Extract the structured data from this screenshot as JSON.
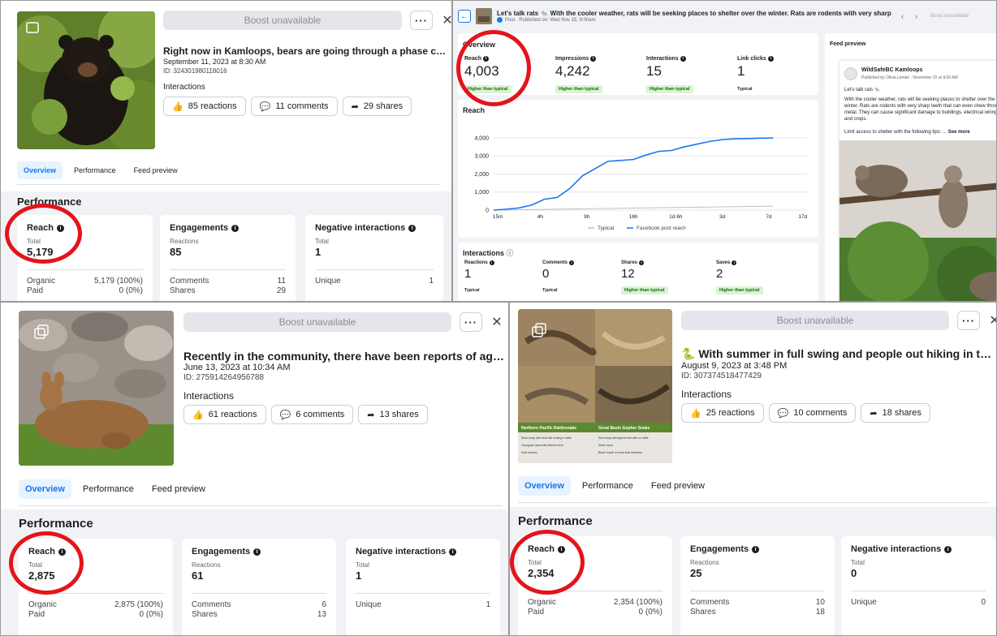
{
  "panels": {
    "bears": {
      "boost_label": "Boost unavailable",
      "title": "Right now in Kamloops, bears are going through a phase called hy...",
      "date": "September 11, 2023 at 8:30 AM",
      "id": "ID: 324301980118016",
      "interactions_label": "Interactions",
      "reactions": "85 reactions",
      "comments": "11 comments",
      "shares": "29 shares",
      "tabs": [
        "Overview",
        "Performance",
        "Feed preview"
      ],
      "performance_heading": "Performance",
      "reach": {
        "title": "Reach",
        "sub": "Total",
        "value": "5,179",
        "rows": [
          [
            "Organic",
            "5,179 (100%)"
          ],
          [
            "Paid",
            "0 (0%)"
          ]
        ]
      },
      "engagements": {
        "title": "Engagements",
        "sub": "Reactions",
        "value": "85",
        "rows": [
          [
            "Comments",
            "11"
          ],
          [
            "Shares",
            "29"
          ]
        ]
      },
      "negative": {
        "title": "Negative interactions",
        "sub": "Total",
        "value": "1",
        "rows": [
          [
            "Unique",
            "1"
          ]
        ]
      }
    },
    "deer": {
      "boost_label": "Boost unavailable",
      "title": "Recently in the community, there have been reports of aggressiv...",
      "date": "June 13, 2023 at 10:34 AM",
      "id": "ID: 275914264956788",
      "interactions_label": "Interactions",
      "reactions": "61 reactions",
      "comments": "6 comments",
      "shares": "13 shares",
      "tabs": [
        "Overview",
        "Performance",
        "Feed preview"
      ],
      "performance_heading": "Performance",
      "reach": {
        "title": "Reach",
        "sub": "Total",
        "value": "2,875",
        "rows": [
          [
            "Organic",
            "2,875 (100%)"
          ],
          [
            "Paid",
            "0 (0%)"
          ]
        ]
      },
      "engagements": {
        "title": "Engagements",
        "sub": "Reactions",
        "value": "61",
        "rows": [
          [
            "Comments",
            "6"
          ],
          [
            "Shares",
            "13"
          ]
        ]
      },
      "negative": {
        "title": "Negative interactions",
        "sub": "Total",
        "value": "1",
        "rows": [
          [
            "Unique",
            "1"
          ]
        ]
      }
    },
    "snakes": {
      "boost_label": "Boost unavailable",
      "title": "🐍 With summer in full swing and people out hiking in the grasslan...",
      "date": "August 9, 2023 at 3:48 PM",
      "id": "ID: 307374518477429",
      "interactions_label": "Interactions",
      "reactions": "25 reactions",
      "comments": "10 comments",
      "shares": "18 shares",
      "tabs": [
        "Overview",
        "Performance",
        "Feed preview"
      ],
      "performance_heading": "Performance",
      "reach": {
        "title": "Reach",
        "sub": "Total",
        "value": "2,354",
        "rows": [
          [
            "Organic",
            "2,354 (100%)"
          ],
          [
            "Paid",
            "0 (0%)"
          ]
        ]
      },
      "engagements": {
        "title": "Engagements",
        "sub": "Reactions",
        "value": "25",
        "rows": [
          [
            "Comments",
            "10"
          ],
          [
            "Shares",
            "18"
          ]
        ]
      },
      "negative": {
        "title": "Negative interactions",
        "sub": "Total",
        "value": "0",
        "rows": [
          [
            "Unique",
            "0"
          ]
        ]
      },
      "image_labels": {
        "left": "Northern Pacific Rattlesnake",
        "left_sub": "Crotalus oreganus",
        "right": "Great Basin Gopher Snake",
        "right_sub": "Pituophis catenifer deserticola",
        "left_lines": [
          "Stout body with blunt tail ending in rattle",
          "Triangular head with distinct neck",
          "Dark cheeks"
        ],
        "right_lines": [
          "Slim body with tapered tail with no rattle",
          "Sleek head",
          "Black 'mask' or band that stretches"
        ]
      }
    },
    "rats": {
      "title": "Let's talk rats 🐀 With the cooler weather, rats will be seeking places to shelter over the winter. Rats are rodents with very sharp teeth th...",
      "meta": "Post · Published on: Wed Nov 15, 9:00am",
      "boost_label": "Boost unavailable",
      "overview_heading": "Overview",
      "metrics": [
        {
          "label": "Reach",
          "value": "4,003",
          "badge": "Higher than typical"
        },
        {
          "label": "Impressions",
          "value": "4,242",
          "badge": "Higher than typical"
        },
        {
          "label": "Interactions",
          "value": "15",
          "badge": "Higher than typical"
        },
        {
          "label": "Link clicks",
          "value": "1",
          "badge": "Typical"
        }
      ],
      "reach_heading": "Reach",
      "legend": {
        "typical": "Typical",
        "fb": "Facebook post reach"
      },
      "interactions_heading": "Interactions",
      "inter_metrics": [
        {
          "label": "Reactions",
          "value": "1",
          "badge": "Typical"
        },
        {
          "label": "Comments",
          "value": "0",
          "badge": "Typical"
        },
        {
          "label": "Shares",
          "value": "12",
          "badge": "Higher than typical"
        },
        {
          "label": "Saves",
          "value": "2",
          "badge": "Higher than typical"
        }
      ],
      "feed_preview": {
        "heading": "Feed preview",
        "page_name": "WildSafeBC Kamloops",
        "published": "Published by Olivia Lemke · November 15 at 9:00 AM",
        "line1": "Let's talk rats 🐀",
        "body": "With the cooler weather, rats will be seeking places to shelter over the winter. Rats are rodents with very sharp teeth that can even chew through metal. They can cause significant damage to buildings, electrical wiring, and crops.",
        "body2": "Limit access to shelter with the following tips: ...",
        "see_more": "See more"
      }
    }
  },
  "chart_data": {
    "type": "line",
    "title": "Reach",
    "x_ticks": [
      "15m",
      "4h",
      "9h",
      "16h",
      "1d 6h",
      "3d",
      "7d",
      "17d"
    ],
    "y_ticks": [
      0,
      1000,
      2000,
      3000,
      4000
    ],
    "ylim": [
      0,
      4400
    ],
    "series": [
      {
        "name": "Facebook post reach",
        "color": "#1877f2",
        "x": [
          0,
          0.3,
          0.6,
          0.9,
          1.2,
          1.5,
          1.8,
          2.1,
          2.4,
          2.7,
          3.0,
          3.3,
          3.6,
          3.9,
          4.2,
          4.5,
          4.8,
          5.1,
          5.4,
          5.7,
          6.0,
          6.3,
          6.6
        ],
        "values": [
          0,
          50,
          120,
          280,
          600,
          700,
          1200,
          1900,
          2300,
          2700,
          2750,
          2800,
          3050,
          3250,
          3300,
          3500,
          3650,
          3800,
          3900,
          3950,
          3960,
          3980,
          3990
        ]
      },
      {
        "name": "Typical",
        "color": "#bcc0c4",
        "x": [
          0,
          6.6
        ],
        "values": [
          0,
          220
        ]
      }
    ],
    "legend": "bottom"
  }
}
